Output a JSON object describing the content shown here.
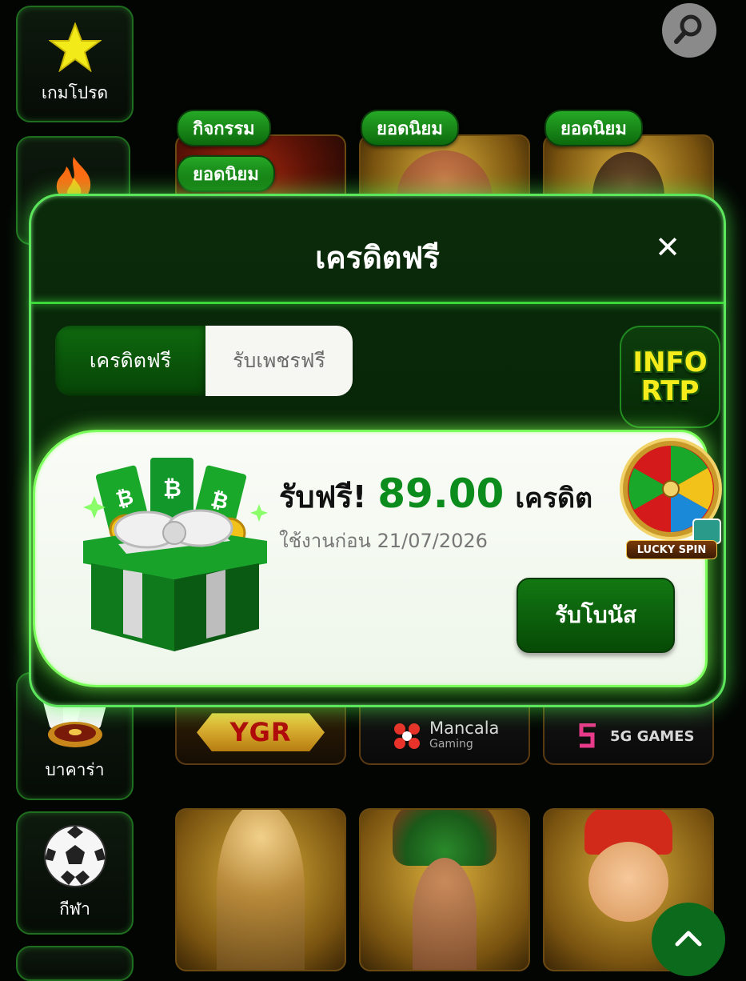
{
  "sidebar": {
    "items": [
      {
        "label": "เกมโปรด",
        "icon": "star-icon"
      },
      {
        "label": "",
        "icon": "fire-icon"
      },
      {
        "label": "บาคาร่า",
        "icon": "cards-roulette-icon"
      },
      {
        "label": "กีฬา",
        "icon": "soccer-ball-icon"
      }
    ]
  },
  "top_tags": {
    "tag1": "กิจกรรม",
    "tag2": "ยอดนิยม",
    "tag3": "ยอดนิยม",
    "tag4": "ยอดนิยม"
  },
  "providers": {
    "ygr": "YGR",
    "mancala": "Mancala",
    "mancala_sub": "Gaming",
    "fiveg": "5G GAMES"
  },
  "modal": {
    "title": "เครดิตฟรี",
    "close_symbol": "✕",
    "tabs": [
      {
        "label": "เครดิตฟรี",
        "active": true
      },
      {
        "label": "รับเพชรฟรี",
        "active": false
      }
    ],
    "info_rtp": {
      "line1": "INFO",
      "line2": "RTP"
    },
    "offer": {
      "label": "รับฟรี!",
      "amount": "89.00",
      "unit": "เครดิต",
      "expiry": "ใช้งานก่อน 21/07/2026",
      "button": "รับโบนัส"
    },
    "lucky_spin": "LUCKY SPIN"
  },
  "colors": {
    "accent_green": "#0c8c1c",
    "glow_green": "#5ce65c",
    "rtp_yellow": "#f5ec1c"
  }
}
